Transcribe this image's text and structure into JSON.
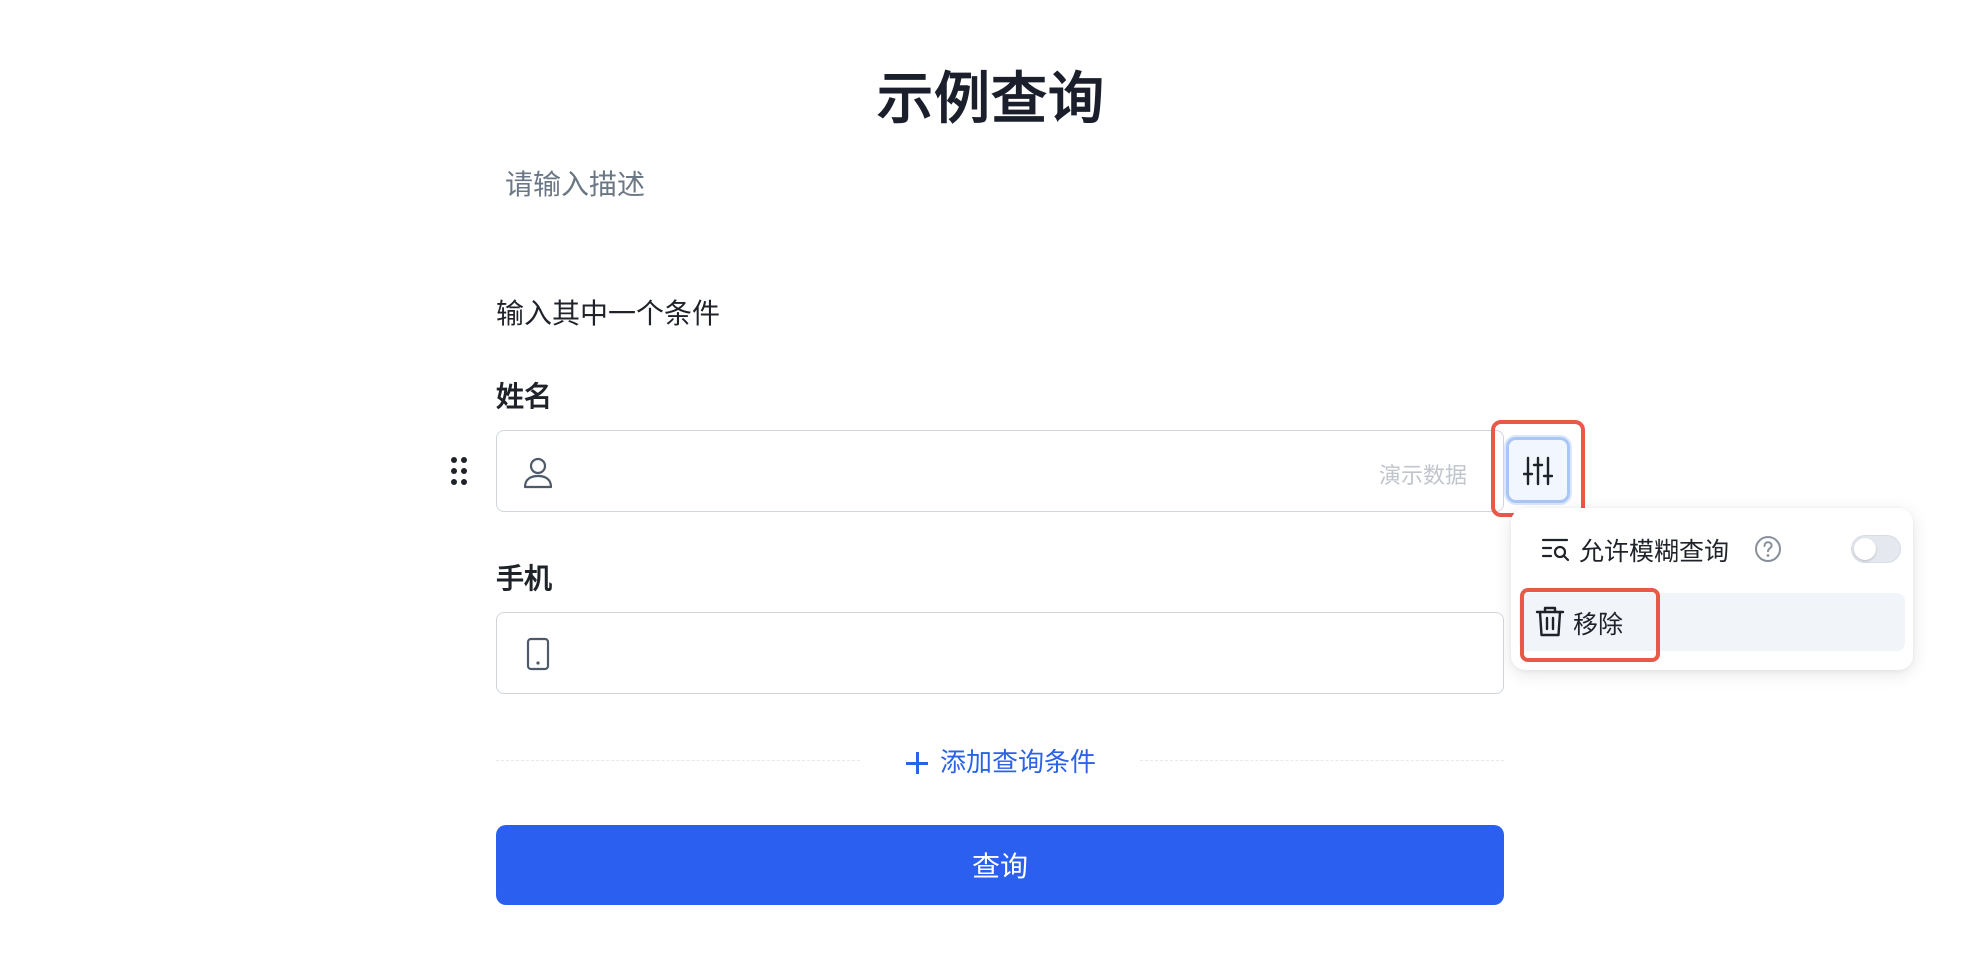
{
  "form": {
    "title": "示例查询",
    "description": "请输入描述",
    "section_label": "输入其中一个条件"
  },
  "fields": {
    "name": {
      "label": "姓名",
      "icon": "user-icon",
      "value": "",
      "suffix_text": "演示数据"
    },
    "phone": {
      "label": "手机",
      "icon": "mobile-phone-icon",
      "value": ""
    }
  },
  "settings_menu": {
    "button_icon": "sliders-icon",
    "fuzzy_query_label": "允许模糊查询",
    "fuzzy_query_enabled": false,
    "remove_label": "移除"
  },
  "actions": {
    "add_condition_label": "添加查询条件",
    "query_label": "查询"
  },
  "colors": {
    "primary": "#2a5ff0",
    "highlight_outline": "#e8594a",
    "link": "#2b62e8"
  }
}
